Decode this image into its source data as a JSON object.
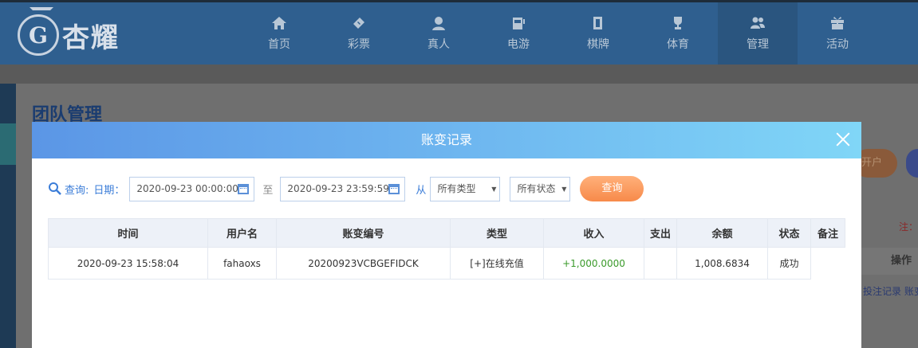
{
  "brand": {
    "logo_letter": "G",
    "name": "杏耀"
  },
  "nav": [
    {
      "label": "首页",
      "icon": "home-icon"
    },
    {
      "label": "彩票",
      "icon": "ticket-icon"
    },
    {
      "label": "真人",
      "icon": "dealer-icon"
    },
    {
      "label": "电游",
      "icon": "slot-machine-icon"
    },
    {
      "label": "棋牌",
      "icon": "cards-icon"
    },
    {
      "label": "体育",
      "icon": "trophy-icon"
    },
    {
      "label": "管理",
      "icon": "users-icon"
    },
    {
      "label": "活动",
      "icon": "gift-icon"
    }
  ],
  "page": {
    "title": "团队管理",
    "bg_button": "开户",
    "bg_note": "注：",
    "bg_column": "操作",
    "bg_links": "投注记录 账变"
  },
  "modal": {
    "title": "账变记录",
    "filter": {
      "query_label": "查询:",
      "date_label": "日期：",
      "start": "2020-09-23 00:00:00",
      "to_label": "至",
      "end": "2020-09-23 23:59:59",
      "from_label": "从",
      "type_selected": "所有类型",
      "status_selected": "所有状态",
      "query_button": "查询"
    },
    "table": {
      "columns": [
        "时间",
        "用户名",
        "账变编号",
        "类型",
        "收入",
        "支出",
        "余额",
        "状态",
        "备注"
      ],
      "rows": [
        {
          "time": "2020-09-23 15:58:04",
          "user": "fahaoxs",
          "serial": "20200923VCBGEFIDCK",
          "type": "[+]在线充值",
          "income": "+1,000.0000",
          "expense": "",
          "balance": "1,008.6834",
          "status": "成功",
          "remark": ""
        }
      ]
    }
  },
  "colors": {
    "nav_bg": "#2f5f8f",
    "modal_header_start": "#5b96e6",
    "modal_header_end": "#80d6f7",
    "accent_blue": "#3b7dd8",
    "query_button": "#f78a4a",
    "income_green": "#3a9a2a"
  }
}
